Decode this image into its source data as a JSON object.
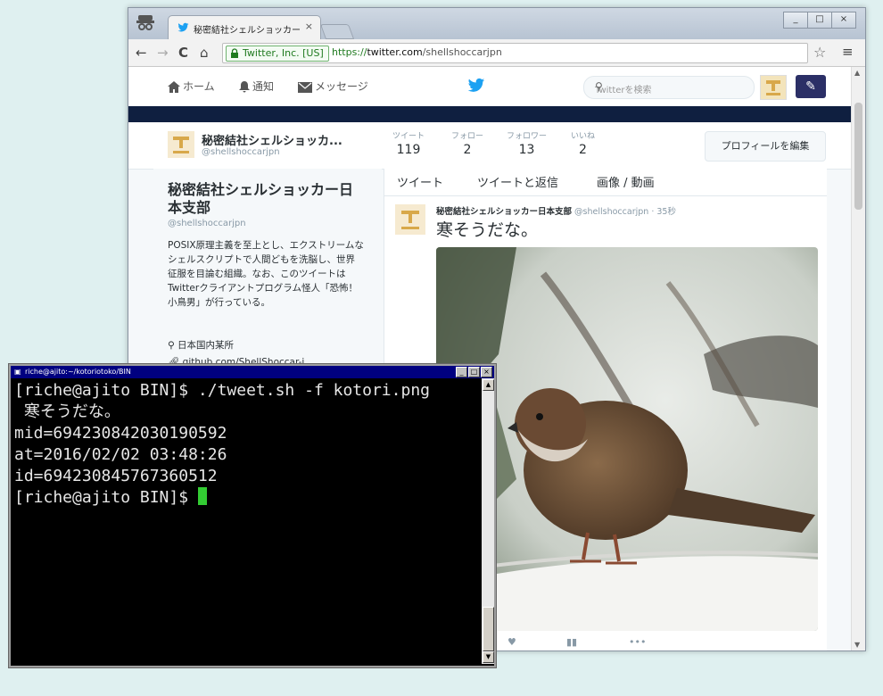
{
  "browser": {
    "tab_title": "秘密結社シェルショッカー日本",
    "tab_close": "×",
    "address": {
      "ev_label": "Twitter, Inc. [US]",
      "scheme": "https://",
      "host": "twitter.com",
      "path": "/shellshoccarjpn"
    }
  },
  "twitter": {
    "nav": {
      "home": "ホーム",
      "notifications": "通知",
      "messages": "メッセージ"
    },
    "search_placeholder": "Twitterを検索",
    "profile": {
      "name_short": "秘密結社シェルショッカ...",
      "handle": "@shellshoccarjpn",
      "stats": [
        {
          "label": "ツイート",
          "value": "119"
        },
        {
          "label": "フォロー",
          "value": "2"
        },
        {
          "label": "フォロワー",
          "value": "13"
        },
        {
          "label": "いいね",
          "value": "2"
        }
      ],
      "edit_button": "プロフィールを編集",
      "full_name": "秘密結社シェルショッカー日本支部",
      "bio": "POSIX原理主義を至上とし、エクストリームなシェルスクリプトで人間どもを洗脳し、世界征服を目論む組織。なお、このツイートはTwitterクライアントプログラム怪人「恐怖！小鳥男」が行っている。",
      "location": "日本国内某所",
      "website": "github.com/ShellShoccar-j..."
    },
    "timeline_tabs": [
      "ツイート",
      "ツイートと返信",
      "画像 / 動画"
    ],
    "tweet": {
      "author": "秘密結社シェルショッカー日本支部",
      "handle": "@shellshoccarjpn",
      "time": "· 35秒",
      "text": "寒そうだな。"
    }
  },
  "terminal": {
    "title": "riche@ajito:~/kotoriotoko/BIN",
    "lines": [
      "[riche@ajito BIN]$ ./tweet.sh -f kotori.png",
      " 寒そうだな。",
      "mid=694230842030190592",
      "at=2016/02/02 03:48:26",
      "id=694230845767360512",
      "[riche@ajito BIN]$ "
    ]
  }
}
